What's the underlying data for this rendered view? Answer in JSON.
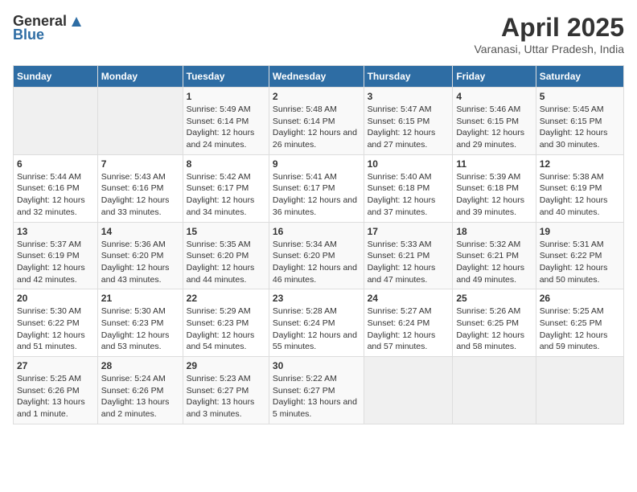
{
  "header": {
    "logo_general": "General",
    "logo_blue": "Blue",
    "month_title": "April 2025",
    "subtitle": "Varanasi, Uttar Pradesh, India"
  },
  "days_of_week": [
    "Sunday",
    "Monday",
    "Tuesday",
    "Wednesday",
    "Thursday",
    "Friday",
    "Saturday"
  ],
  "weeks": [
    [
      {
        "day": null
      },
      {
        "day": null
      },
      {
        "day": "1",
        "sunrise": "5:49 AM",
        "sunset": "6:14 PM",
        "daylight": "12 hours and 24 minutes."
      },
      {
        "day": "2",
        "sunrise": "5:48 AM",
        "sunset": "6:14 PM",
        "daylight": "12 hours and 26 minutes."
      },
      {
        "day": "3",
        "sunrise": "5:47 AM",
        "sunset": "6:15 PM",
        "daylight": "12 hours and 27 minutes."
      },
      {
        "day": "4",
        "sunrise": "5:46 AM",
        "sunset": "6:15 PM",
        "daylight": "12 hours and 29 minutes."
      },
      {
        "day": "5",
        "sunrise": "5:45 AM",
        "sunset": "6:15 PM",
        "daylight": "12 hours and 30 minutes."
      }
    ],
    [
      {
        "day": "6",
        "sunrise": "5:44 AM",
        "sunset": "6:16 PM",
        "daylight": "12 hours and 32 minutes."
      },
      {
        "day": "7",
        "sunrise": "5:43 AM",
        "sunset": "6:16 PM",
        "daylight": "12 hours and 33 minutes."
      },
      {
        "day": "8",
        "sunrise": "5:42 AM",
        "sunset": "6:17 PM",
        "daylight": "12 hours and 34 minutes."
      },
      {
        "day": "9",
        "sunrise": "5:41 AM",
        "sunset": "6:17 PM",
        "daylight": "12 hours and 36 minutes."
      },
      {
        "day": "10",
        "sunrise": "5:40 AM",
        "sunset": "6:18 PM",
        "daylight": "12 hours and 37 minutes."
      },
      {
        "day": "11",
        "sunrise": "5:39 AM",
        "sunset": "6:18 PM",
        "daylight": "12 hours and 39 minutes."
      },
      {
        "day": "12",
        "sunrise": "5:38 AM",
        "sunset": "6:19 PM",
        "daylight": "12 hours and 40 minutes."
      }
    ],
    [
      {
        "day": "13",
        "sunrise": "5:37 AM",
        "sunset": "6:19 PM",
        "daylight": "12 hours and 42 minutes."
      },
      {
        "day": "14",
        "sunrise": "5:36 AM",
        "sunset": "6:20 PM",
        "daylight": "12 hours and 43 minutes."
      },
      {
        "day": "15",
        "sunrise": "5:35 AM",
        "sunset": "6:20 PM",
        "daylight": "12 hours and 44 minutes."
      },
      {
        "day": "16",
        "sunrise": "5:34 AM",
        "sunset": "6:20 PM",
        "daylight": "12 hours and 46 minutes."
      },
      {
        "day": "17",
        "sunrise": "5:33 AM",
        "sunset": "6:21 PM",
        "daylight": "12 hours and 47 minutes."
      },
      {
        "day": "18",
        "sunrise": "5:32 AM",
        "sunset": "6:21 PM",
        "daylight": "12 hours and 49 minutes."
      },
      {
        "day": "19",
        "sunrise": "5:31 AM",
        "sunset": "6:22 PM",
        "daylight": "12 hours and 50 minutes."
      }
    ],
    [
      {
        "day": "20",
        "sunrise": "5:30 AM",
        "sunset": "6:22 PM",
        "daylight": "12 hours and 51 minutes."
      },
      {
        "day": "21",
        "sunrise": "5:30 AM",
        "sunset": "6:23 PM",
        "daylight": "12 hours and 53 minutes."
      },
      {
        "day": "22",
        "sunrise": "5:29 AM",
        "sunset": "6:23 PM",
        "daylight": "12 hours and 54 minutes."
      },
      {
        "day": "23",
        "sunrise": "5:28 AM",
        "sunset": "6:24 PM",
        "daylight": "12 hours and 55 minutes."
      },
      {
        "day": "24",
        "sunrise": "5:27 AM",
        "sunset": "6:24 PM",
        "daylight": "12 hours and 57 minutes."
      },
      {
        "day": "25",
        "sunrise": "5:26 AM",
        "sunset": "6:25 PM",
        "daylight": "12 hours and 58 minutes."
      },
      {
        "day": "26",
        "sunrise": "5:25 AM",
        "sunset": "6:25 PM",
        "daylight": "12 hours and 59 minutes."
      }
    ],
    [
      {
        "day": "27",
        "sunrise": "5:25 AM",
        "sunset": "6:26 PM",
        "daylight": "13 hours and 1 minute."
      },
      {
        "day": "28",
        "sunrise": "5:24 AM",
        "sunset": "6:26 PM",
        "daylight": "13 hours and 2 minutes."
      },
      {
        "day": "29",
        "sunrise": "5:23 AM",
        "sunset": "6:27 PM",
        "daylight": "13 hours and 3 minutes."
      },
      {
        "day": "30",
        "sunrise": "5:22 AM",
        "sunset": "6:27 PM",
        "daylight": "13 hours and 5 minutes."
      },
      {
        "day": null
      },
      {
        "day": null
      },
      {
        "day": null
      }
    ]
  ]
}
